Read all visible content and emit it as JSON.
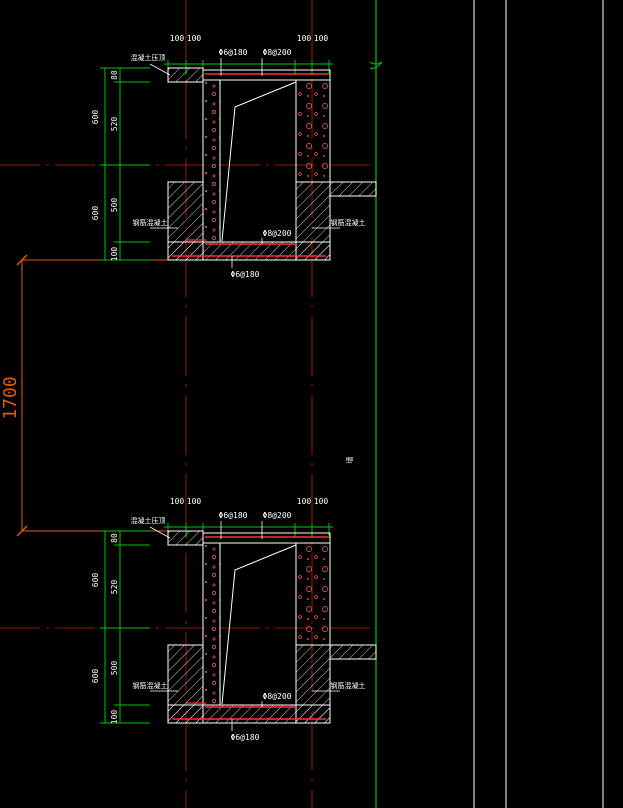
{
  "colors": {
    "background": "#000000",
    "outline": "#ffffff",
    "dimension": "#00c800",
    "rebar": "#ff3030",
    "axis": "#c82000",
    "overall_dimension": "#e05a10",
    "grid_line": "#00c800",
    "hatch": "#ffffff"
  },
  "overall_dimension": {
    "value": "1700"
  },
  "sections": [
    {
      "top_dims": [
        "100",
        "100",
        "100",
        "100"
      ],
      "top_rebar_1": "Φ6@180",
      "top_rebar_2": "Φ8@200",
      "bottom_rebar_1": "Φ8@200",
      "bottom_rebar_2": "Φ6@180",
      "height_dims": {
        "upper_total": "600",
        "lower_total": "600",
        "a": "80",
        "b": "520",
        "c": "500",
        "d": "100"
      },
      "callout_top_left": "混凝土压顶",
      "callout_left": "钢筋混凝土",
      "callout_right": "钢筋混凝土"
    },
    {
      "top_dims": [
        "100",
        "100",
        "100",
        "100"
      ],
      "top_rebar_1": "Φ6@180",
      "top_rebar_2": "Φ8@200",
      "bottom_rebar_1": "Φ8@200",
      "bottom_rebar_2": "Φ6@180",
      "height_dims": {
        "upper_total": "600",
        "lower_total": "600",
        "a": "80",
        "b": "520",
        "c": "500",
        "d": "100"
      },
      "callout_top_left": "混凝土压顶",
      "callout_left": "钢筋混凝土",
      "callout_right": "钢筋混凝土"
    }
  ],
  "side_note": "墙"
}
